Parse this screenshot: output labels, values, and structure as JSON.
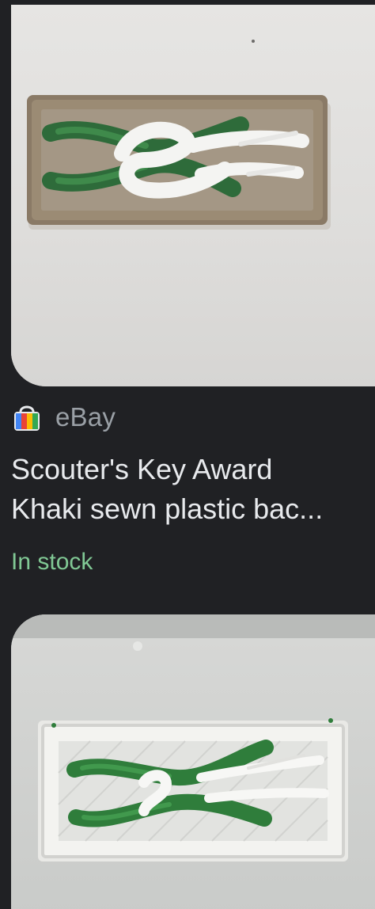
{
  "results": [
    {
      "image": {
        "alt_subject": "knot-patch-khaki-icon"
      },
      "source": {
        "name": "eBay",
        "icon": "shopping-bag-icon"
      },
      "title_lines": [
        "Scouter's Key Award",
        "Khaki sewn plastic bac..."
      ],
      "availability": "In stock"
    },
    {
      "image": {
        "alt_subject": "knot-patch-white-icon"
      }
    }
  ],
  "colors": {
    "background": "#202124",
    "source_text": "#9aa0a6",
    "title_text": "#e8eaed",
    "availability_text": "#81c995"
  }
}
